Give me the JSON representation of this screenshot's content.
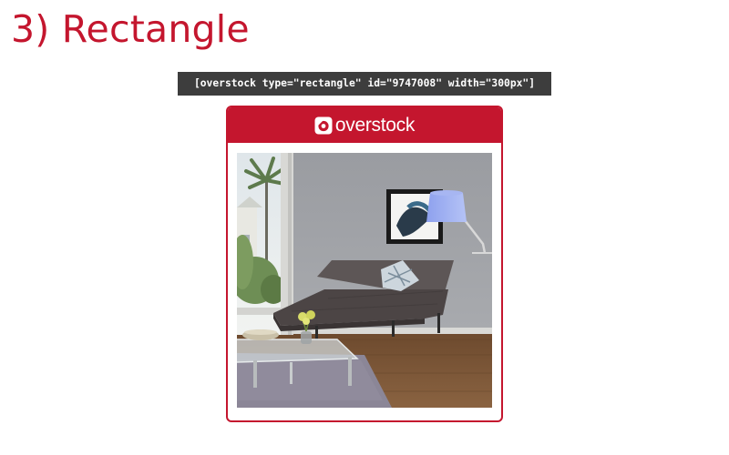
{
  "section": {
    "title": "3) Rectangle"
  },
  "shortcode": {
    "text": "[overstock type=\"rectangle\" id=\"9747008\" width=\"300px\"]"
  },
  "widget": {
    "brand": "overstock",
    "brand_icon": "overstock-logo-icon",
    "product_image": "chaise-lounge-living-room-photo"
  },
  "colors": {
    "accent": "#c4162e",
    "code_background": "#3d3d3d"
  }
}
